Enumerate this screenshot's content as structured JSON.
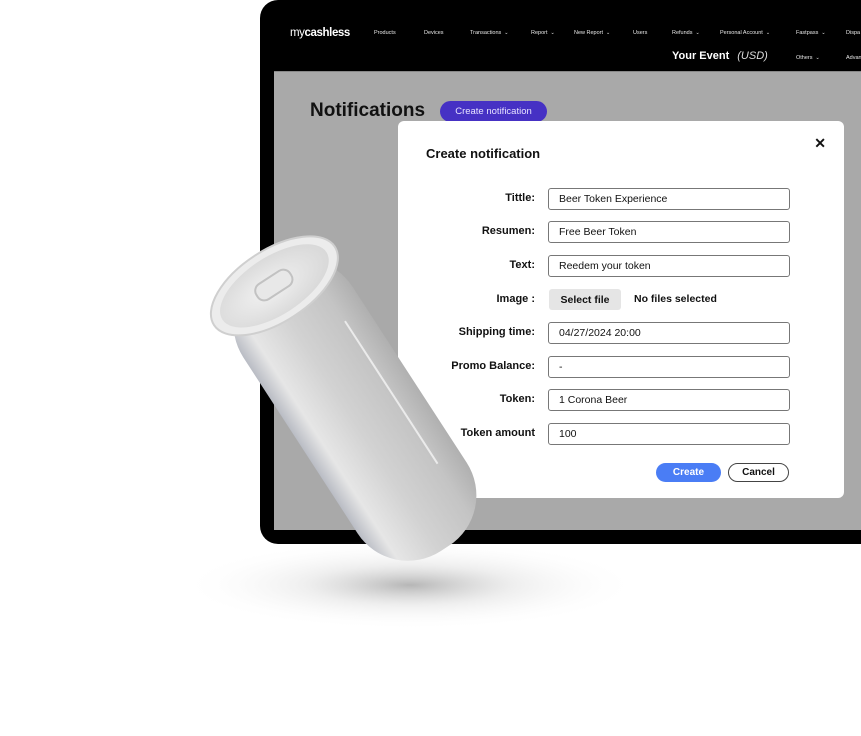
{
  "app": {
    "logo_prefix": "my",
    "logo_brand": "cashless"
  },
  "nav": {
    "items": [
      {
        "label": "Products",
        "dropdown": false
      },
      {
        "label": "Devices",
        "dropdown": false
      },
      {
        "label": "Transactions",
        "dropdown": true
      },
      {
        "label": "Report",
        "dropdown": true
      },
      {
        "label": "New Report",
        "dropdown": true
      },
      {
        "label": "Users",
        "dropdown": false
      },
      {
        "label": "Refunds",
        "dropdown": true
      },
      {
        "label": "Personal Account",
        "dropdown": true
      },
      {
        "label": "Fastpass",
        "dropdown": true
      },
      {
        "label": "Dispa",
        "dropdown": false
      }
    ],
    "row2": [
      {
        "label": "Others",
        "dropdown": true
      },
      {
        "label": "Advan",
        "dropdown": false
      }
    ],
    "chevron_icon": "chevron-down-icon",
    "event_name": "Your Event",
    "event_currency": "(USD)"
  },
  "page": {
    "title": "Notifications",
    "create_button": "Create notification"
  },
  "dialog": {
    "title": "Create notification",
    "close_icon": "close-icon",
    "fields": [
      {
        "label": "Tittle:",
        "value": "Beer Token Experience"
      },
      {
        "label": "Resumen:",
        "value": "Free Beer Token"
      },
      {
        "label": "Text:",
        "value": "Reedem your token"
      },
      {
        "label": "Shipping time:",
        "value": "04/27/2024 20:00"
      },
      {
        "label": "Promo Balance:",
        "value": "-"
      },
      {
        "label": "Token:",
        "value": "1 Corona Beer"
      },
      {
        "label": "Token amount",
        "value": "100"
      }
    ],
    "image": {
      "label": "Image :",
      "button": "Select file",
      "status": "No files selected"
    },
    "create_button": "Create",
    "cancel_button": "Cancel"
  },
  "colors": {
    "primary_purple": "#4631c4",
    "create_blue": "#4a7df5",
    "screen_gray": "#a9a9a9",
    "frame_black": "#000000"
  }
}
